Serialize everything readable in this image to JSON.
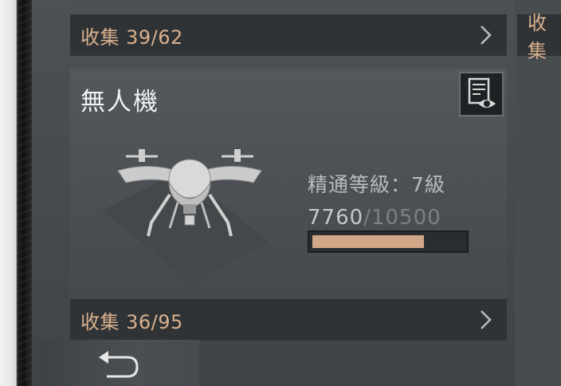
{
  "collections": {
    "top_label": "收集 39/62",
    "right_label": "收集",
    "bottom_label": "收集 36/95"
  },
  "drone_card": {
    "title": "無人機",
    "mastery_label": "精通等級：7級",
    "xp_current": "7760",
    "xp_separator": "/",
    "xp_max": "10500",
    "xp_progress": 0.739
  },
  "colors": {
    "accent": "#d9b08d",
    "xp_fill": "#d0a687"
  },
  "icons": {
    "collection_arrow": "chevron-right-icon",
    "info": "list-eye-icon",
    "back": "return-arrow-icon"
  }
}
